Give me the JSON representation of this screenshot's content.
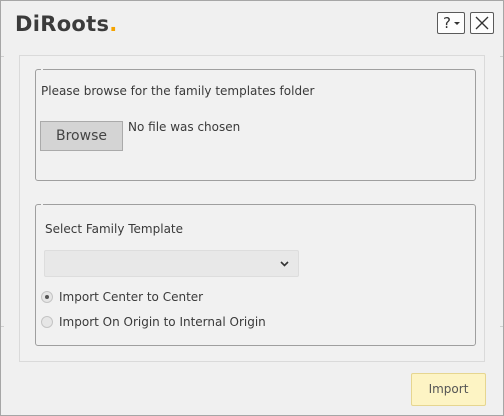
{
  "window": {
    "logo": {
      "text": "DiRoots",
      "accent": "."
    },
    "help_label": "?",
    "close_label": "X"
  },
  "folder_group": {
    "prompt": "Please browse for the family templates folder",
    "browse_label": "Browse",
    "status": "No file was chosen"
  },
  "template_group": {
    "label": "Select Family Template",
    "select_value": "",
    "options": [
      {
        "label": "Import Center to Center",
        "checked": true
      },
      {
        "label": "Import On Origin to Internal Origin",
        "checked": false
      }
    ]
  },
  "footer": {
    "import_label": "Import"
  },
  "colors": {
    "accent": "#f5a300",
    "import_button_bg": "#fdf4c4",
    "window_bg": "#f0f0f0"
  }
}
